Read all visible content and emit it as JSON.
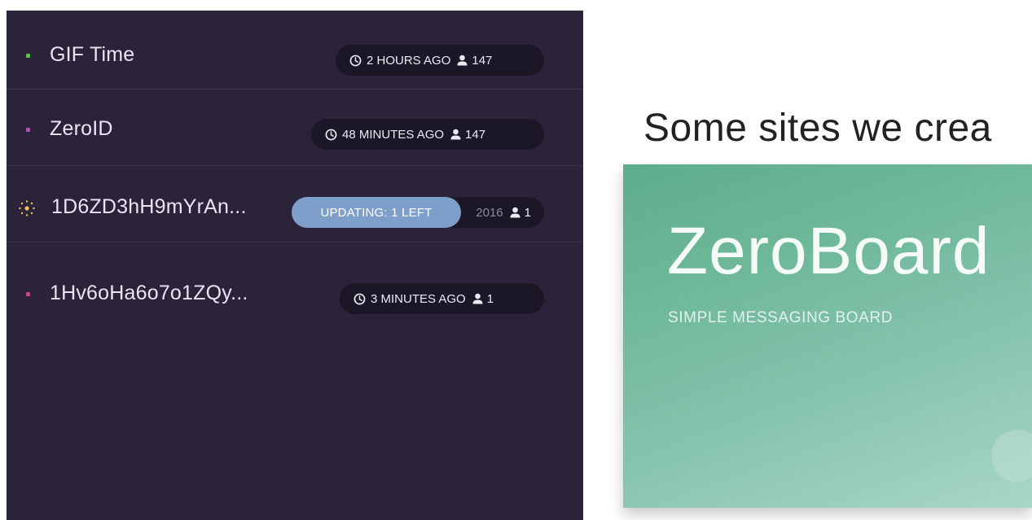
{
  "sidebar": {
    "sites": [
      {
        "title": "GIF Time",
        "time": "2 HOURS AGO",
        "peers": "147",
        "dot_color": "#5fbf4a",
        "status": "online"
      },
      {
        "title": "ZeroID",
        "time": "48 MINUTES AGO",
        "peers": "147",
        "dot_color": "#b25aa7",
        "status": "online"
      },
      {
        "title": "1D6ZD3hH9mYrAn...",
        "time": "2016",
        "peers": "1",
        "status": "updating",
        "updating_label": "UPDATING: 1 LEFT"
      },
      {
        "title": "1Hv6oHa6o7o1ZQy...",
        "time": "3 MINUTES AGO",
        "peers": "1",
        "dot_color": "#c44b7d",
        "status": "online"
      }
    ]
  },
  "main": {
    "heading": "Some sites we crea",
    "featured": {
      "title": "ZeroBoard",
      "subtitle": "SIMPLE MESSAGING BOARD"
    }
  },
  "icons": {
    "clock": "clock-icon",
    "peers": "person-icon",
    "spinner": "loading-spinner-icon"
  }
}
